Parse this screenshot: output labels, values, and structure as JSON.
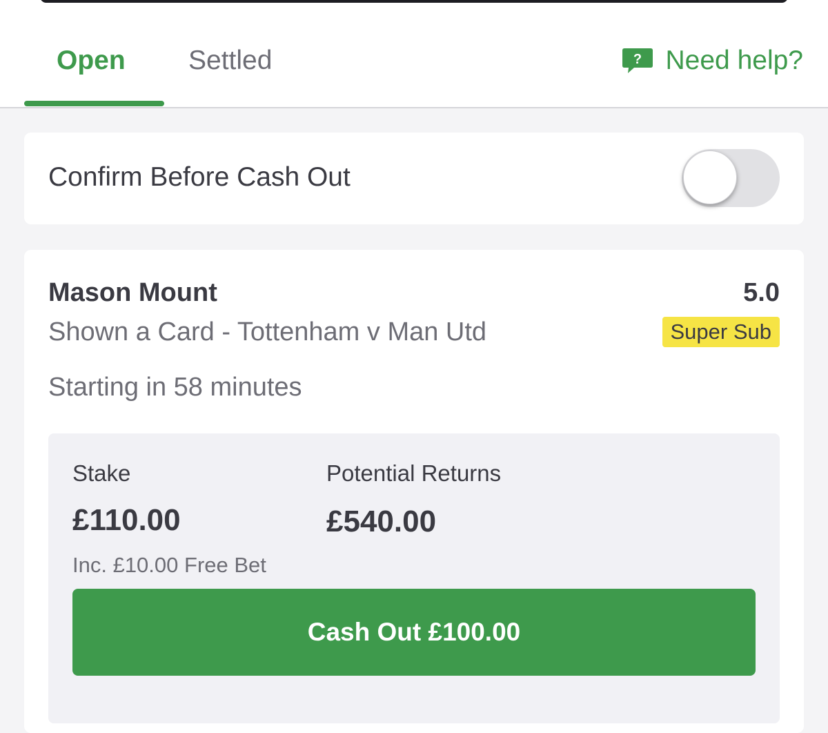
{
  "tabs": [
    {
      "label": "Open",
      "active": true
    },
    {
      "label": "Settled",
      "active": false
    }
  ],
  "help": {
    "label": "Need help?",
    "icon": "help-chat-icon",
    "icon_glyph": "?"
  },
  "settings": {
    "confirm_cash_out_label": "Confirm Before Cash Out",
    "confirm_cash_out_enabled": false
  },
  "bet": {
    "selection": "Mason Mount",
    "odds": "5.0",
    "market": "Shown a Card - Tottenham v Man Utd",
    "badge": "Super Sub",
    "start_time": "Starting in 58 minutes",
    "stake_label": "Stake",
    "stake_value": "£110.00",
    "free_bet_note": "Inc. £10.00 Free Bet",
    "returns_label": "Potential Returns",
    "returns_value": "£540.00",
    "cash_out_label": "Cash Out £100.00"
  },
  "colors": {
    "brand_green": "#3e9a4c",
    "badge_yellow": "#f6e445",
    "text_dark": "#3a3a42",
    "text_muted": "#6d6d75",
    "page_bg": "#f4f4f6"
  }
}
